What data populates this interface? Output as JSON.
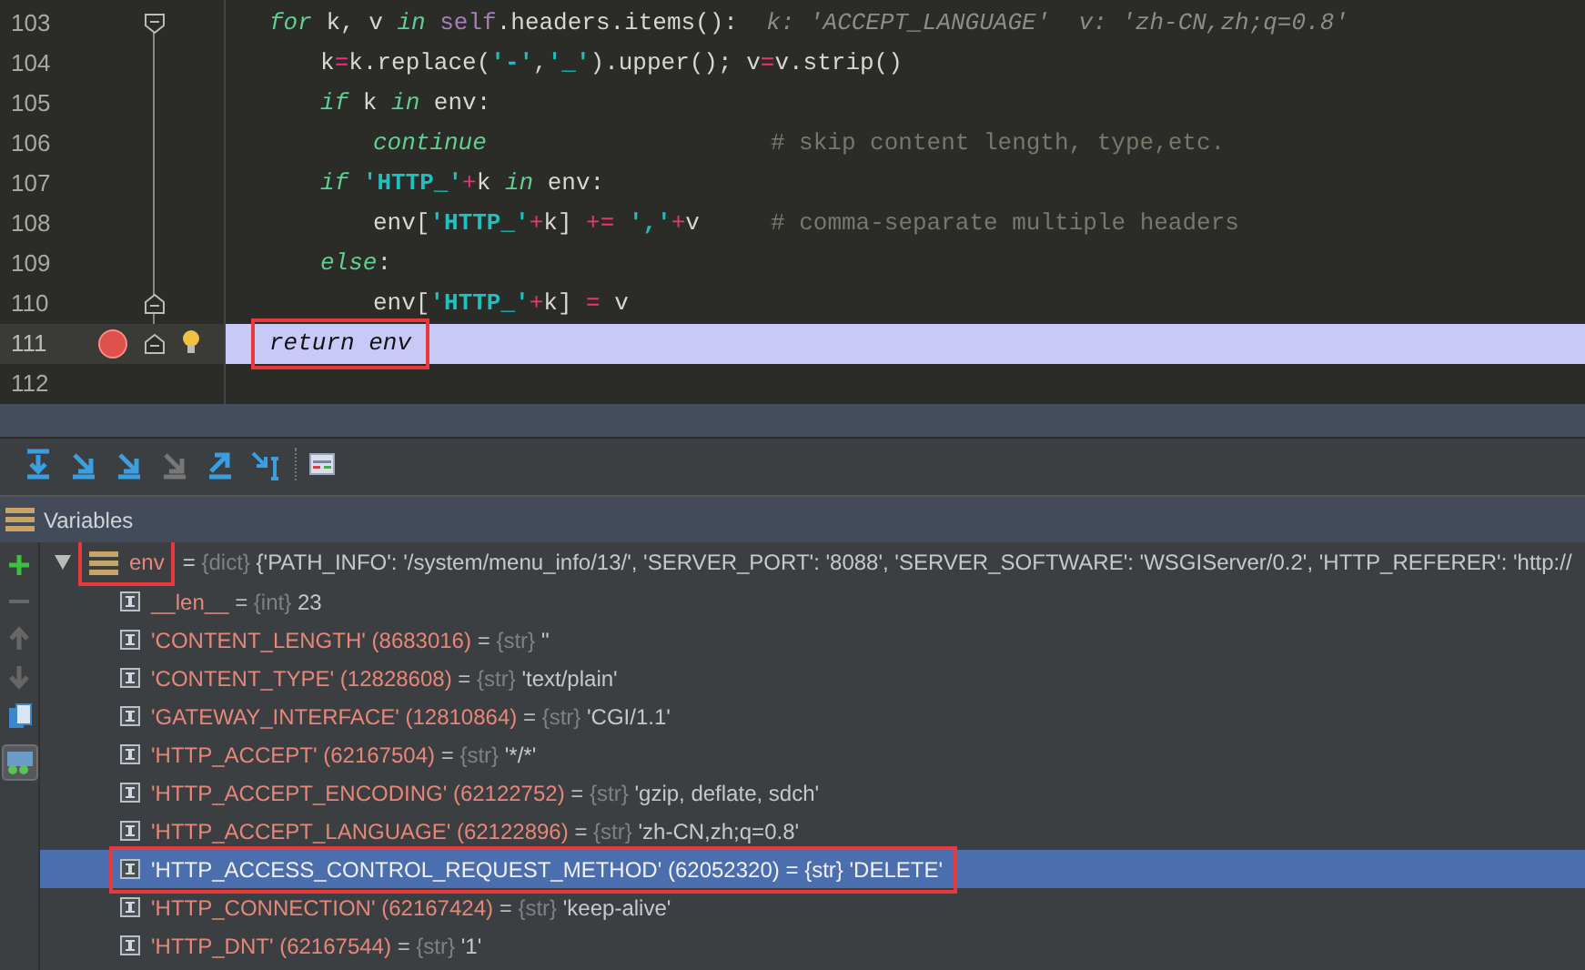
{
  "editor": {
    "lines": [
      {
        "number": "103",
        "fold_start": true,
        "fold_end": false,
        "breakpoint": false,
        "current": false,
        "outlined": false,
        "tokens": [
          {
            "kind": "kw",
            "text": "for"
          },
          {
            "kind": "plain",
            "text": " k, v "
          },
          {
            "kind": "kw",
            "text": "in "
          },
          {
            "kind": "self",
            "text": "self"
          },
          {
            "kind": "plain",
            "text": ".headers.items():  "
          },
          {
            "kind": "hint",
            "text": "k: 'ACCEPT_LANGUAGE'  v: 'zh-CN,zh;q=0.8'"
          }
        ],
        "children": [
          {
            "number": "104",
            "fold_start": false,
            "fold_end": false,
            "breakpoint": false,
            "current": false,
            "outlined": false,
            "tokens": [
              {
                "kind": "plain",
                "text": "k"
              },
              {
                "kind": "op",
                "text": "="
              },
              {
                "kind": "plain",
                "text": "k.replace("
              },
              {
                "kind": "str",
                "text": "'-'"
              },
              {
                "kind": "plain",
                "text": ","
              },
              {
                "kind": "str",
                "text": "'_'"
              },
              {
                "kind": "plain",
                "text": ").upper(); v"
              },
              {
                "kind": "op",
                "text": "="
              },
              {
                "kind": "plain",
                "text": "v.strip()"
              }
            ]
          },
          {
            "number": "105",
            "fold_start": false,
            "fold_end": false,
            "breakpoint": false,
            "current": false,
            "outlined": false,
            "tokens": [
              {
                "kind": "kw",
                "text": "if"
              },
              {
                "kind": "plain",
                "text": " k "
              },
              {
                "kind": "kw",
                "text": "in"
              },
              {
                "kind": "plain",
                "text": " env:"
              }
            ],
            "children": [
              {
                "number": "106",
                "fold_start": false,
                "fold_end": false,
                "breakpoint": false,
                "current": false,
                "outlined": false,
                "tokens": [
                  {
                    "kind": "kw",
                    "text": "continue"
                  },
                  {
                    "kind": "comment",
                    "text": "                    # skip content length, type,etc."
                  }
                ]
              }
            ]
          },
          {
            "number": "107",
            "fold_start": false,
            "fold_end": false,
            "breakpoint": false,
            "current": false,
            "outlined": false,
            "tokens": [
              {
                "kind": "kw",
                "text": "if "
              },
              {
                "kind": "str",
                "text": "'HTTP_'"
              },
              {
                "kind": "op",
                "text": "+"
              },
              {
                "kind": "plain",
                "text": "k "
              },
              {
                "kind": "kw",
                "text": "in"
              },
              {
                "kind": "plain",
                "text": " env:"
              }
            ],
            "children": [
              {
                "number": "108",
                "fold_start": false,
                "fold_end": false,
                "breakpoint": false,
                "current": false,
                "outlined": false,
                "tokens": [
                  {
                    "kind": "plain",
                    "text": "env["
                  },
                  {
                    "kind": "str",
                    "text": "'HTTP_'"
                  },
                  {
                    "kind": "op",
                    "text": "+"
                  },
                  {
                    "kind": "plain",
                    "text": "k] "
                  },
                  {
                    "kind": "op",
                    "text": "+= "
                  },
                  {
                    "kind": "str",
                    "text": "','"
                  },
                  {
                    "kind": "op",
                    "text": "+"
                  },
                  {
                    "kind": "plain",
                    "text": "v"
                  },
                  {
                    "kind": "comment",
                    "text": "     # comma-separate multiple headers"
                  }
                ]
              }
            ]
          },
          {
            "number": "109",
            "fold_start": false,
            "fold_end": false,
            "breakpoint": false,
            "current": false,
            "outlined": false,
            "tokens": [
              {
                "kind": "kw",
                "text": "else"
              },
              {
                "kind": "plain",
                "text": ":"
              }
            ],
            "children": [
              {
                "number": "110",
                "fold_start": false,
                "fold_end": true,
                "breakpoint": false,
                "current": false,
                "outlined": false,
                "tokens": [
                  {
                    "kind": "plain",
                    "text": "env["
                  },
                  {
                    "kind": "str",
                    "text": "'HTTP_'"
                  },
                  {
                    "kind": "op",
                    "text": "+"
                  },
                  {
                    "kind": "plain",
                    "text": "k] "
                  },
                  {
                    "kind": "op",
                    "text": "="
                  },
                  {
                    "kind": "plain",
                    "text": " v"
                  }
                ]
              }
            ]
          }
        ]
      },
      {
        "number": "111",
        "fold_start": false,
        "fold_end": true,
        "breakpoint": true,
        "current": true,
        "outlined": true,
        "tokens": [
          {
            "kind": "kw",
            "text": "return"
          },
          {
            "kind": "plain",
            "text": " env"
          }
        ]
      },
      {
        "number": "112",
        "fold_start": false,
        "fold_end": false,
        "breakpoint": false,
        "current": false
      }
    ]
  },
  "variables": {
    "title": "Variables",
    "root": {
      "name": "env",
      "eq": "=",
      "type": "{dict}",
      "value": "{'PATH_INFO': '/system/menu_info/13/', 'SERVER_PORT': '8088', 'SERVER_SOFTWARE': 'WSGIServer/0.2', 'HTTP_REFERER': 'http://",
      "expanded": true,
      "outlined": true
    },
    "children": [
      {
        "name": "__len__",
        "eq": "=",
        "type": "{int}",
        "value": "23",
        "selected": false,
        "outlined": false
      },
      {
        "name": "'CONTENT_LENGTH'",
        "id": "(8683016)",
        "eq": "=",
        "type": "{str}",
        "value": "''",
        "selected": false,
        "outlined": false
      },
      {
        "name": "'CONTENT_TYPE'",
        "id": "(12828608)",
        "eq": "=",
        "type": "{str}",
        "value": "'text/plain'",
        "selected": false,
        "outlined": false
      },
      {
        "name": "'GATEWAY_INTERFACE'",
        "id": "(12810864)",
        "eq": "=",
        "type": "{str}",
        "value": "'CGI/1.1'",
        "selected": false,
        "outlined": false
      },
      {
        "name": "'HTTP_ACCEPT'",
        "id": "(62167504)",
        "eq": "=",
        "type": "{str}",
        "value": "'*/*'",
        "selected": false,
        "outlined": false
      },
      {
        "name": "'HTTP_ACCEPT_ENCODING'",
        "id": "(62122752)",
        "eq": "=",
        "type": "{str}",
        "value": "'gzip, deflate, sdch'",
        "selected": false,
        "outlined": false
      },
      {
        "name": "'HTTP_ACCEPT_LANGUAGE'",
        "id": "(62122896)",
        "eq": "=",
        "type": "{str}",
        "value": "'zh-CN,zh;q=0.8'",
        "selected": false,
        "outlined": false
      },
      {
        "name": "'HTTP_ACCESS_CONTROL_REQUEST_METHOD'",
        "id": "(62052320)",
        "eq": "=",
        "type": "{str}",
        "value": "'DELETE'",
        "selected": true,
        "outlined": true
      },
      {
        "name": "'HTTP_CONNECTION'",
        "id": "(62167424)",
        "eq": "=",
        "type": "{str}",
        "value": "'keep-alive'",
        "selected": false,
        "outlined": false
      },
      {
        "name": "'HTTP_DNT'",
        "id": "(62167544)",
        "eq": "=",
        "type": "{str}",
        "value": "'1'",
        "selected": false,
        "outlined": false
      }
    ]
  }
}
